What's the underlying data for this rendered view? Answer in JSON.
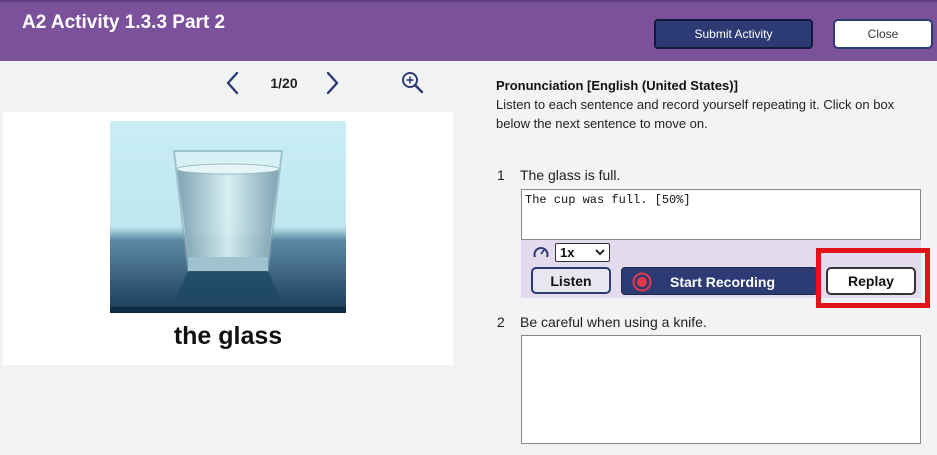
{
  "header": {
    "title": "A2 Activity 1.3.3 Part 2",
    "submit_label": "Submit Activity",
    "close_label": "Close"
  },
  "viewer": {
    "page_indicator": "1/20",
    "caption": "the glass"
  },
  "instructions": {
    "title": "Pronunciation [English (United States)]",
    "text": "Listen to each sentence and record yourself repeating it. Click on box below the next sentence to move on."
  },
  "questions": [
    {
      "number": "1",
      "sentence": "The glass is full.",
      "answer": "The cup was full. [50%]"
    },
    {
      "number": "2",
      "sentence": "Be careful when using a knife.",
      "answer": ""
    }
  ],
  "recorder": {
    "speed": "1x",
    "listen_label": "Listen",
    "record_label": "Start Recording",
    "replay_label": "Replay"
  },
  "colors": {
    "header_bg": "#7b519c",
    "primary_button": "#2d3b74",
    "recorder_panel": "#e5dbee",
    "highlight": "#e2121b"
  }
}
